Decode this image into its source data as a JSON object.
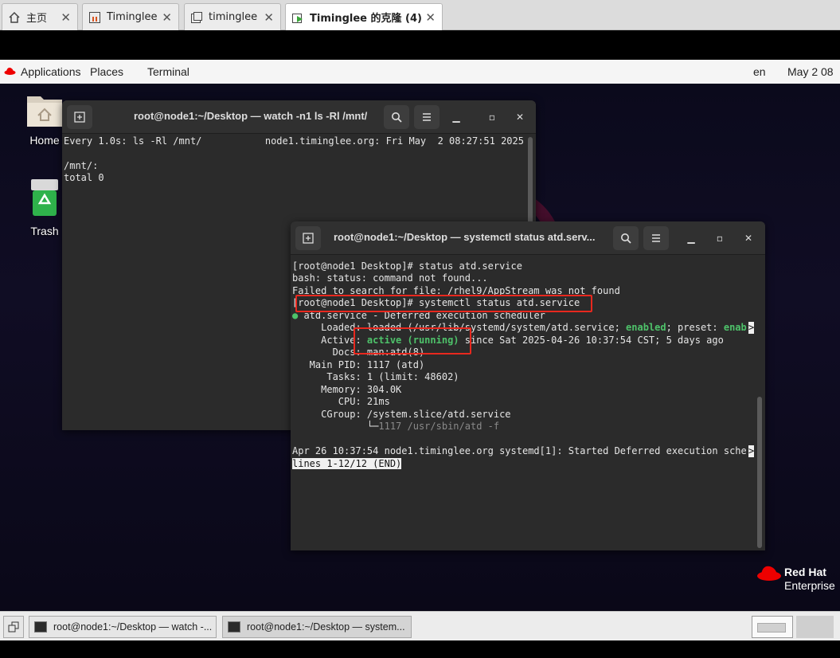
{
  "browser_tabs": [
    {
      "label": "主页",
      "icon": "home-icon"
    },
    {
      "label": "Timinglee",
      "icon": "vm-icon"
    },
    {
      "label": "timinglee",
      "icon": "window-icon"
    },
    {
      "label": "Timinglee 的克隆 (4)",
      "icon": "vm-running-icon",
      "active": true
    }
  ],
  "topbar": {
    "applications": "Applications",
    "places": "Places",
    "terminal": "Terminal",
    "lang": "en",
    "clock": "May 2  08"
  },
  "desktop_icons": [
    {
      "label": "Home",
      "icon": "home-folder-icon"
    },
    {
      "label": "Trash",
      "icon": "trash-icon"
    }
  ],
  "term1": {
    "title": "root@node1:~/Desktop — watch -n1 ls -Rl /mnt/",
    "lines": [
      "Every 1.0s: ls -Rl /mnt/           node1.timinglee.org: Fri May  2 08:27:51 2025",
      "",
      "/mnt/:",
      "total 0"
    ]
  },
  "term2": {
    "title": "root@node1:~/Desktop — systemctl status atd.serv...",
    "l1": "[root@node1 Desktop]# status atd.service",
    "l2": "bash: status: command not found...",
    "l3": "Failed to search for file: /rhel9/AppStream was not found",
    "l4": "[root@node1 Desktop]# systemctl status atd.service",
    "l5_dot": "●",
    "l5": " atd.service - Deferred execution scheduler",
    "l6a": "     Loaded: loaded (/usr/lib/systemd/system/atd.service; ",
    "l6b": "enabled",
    "l6c": "; preset: ",
    "l6d": "enab",
    "l7a": "     Active: ",
    "l7b": "active (running)",
    "l7c": " since Sat 2025-04-26 10:37:54 CST; 5 days ago",
    "l8": "       Docs: man:atd(8)",
    "l9": "   Main PID: 1117 (atd)",
    "l10": "      Tasks: 1 (limit: 48602)",
    "l11": "     Memory: 304.0K",
    "l12": "        CPU: 21ms",
    "l13": "     CGroup: /system.slice/atd.service",
    "l14a": "             └─",
    "l14b": "1117 /usr/sbin/atd -f",
    "l15": "",
    "l16": "Apr 26 10:37:54 node1.timinglee.org systemd[1]: Started Deferred execution sche",
    "l17": "lines 1-12/12 (END)",
    "overflow_marker": ">"
  },
  "branding": {
    "line1": "Red Hat",
    "line2": "Enterprise"
  },
  "taskbar": [
    {
      "label": "root@node1:~/Desktop — watch -..."
    },
    {
      "label": "root@node1:~/Desktop — system...",
      "active": true
    }
  ],
  "colors": {
    "accent_red": "#e8281e",
    "green": "#4ec26a",
    "terminal_bg": "#2b2b2b"
  }
}
